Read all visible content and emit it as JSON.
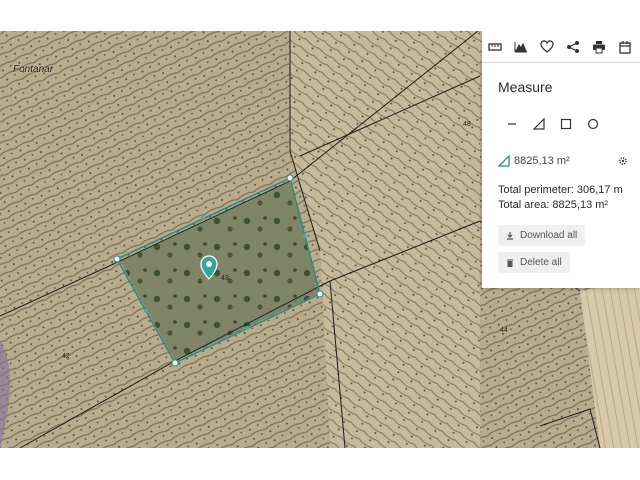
{
  "map": {
    "place_label": "Fontanar",
    "parcel_numbers": [
      "43",
      "48",
      "42",
      "44"
    ],
    "colors": {
      "terrain_base": "#b7a98c",
      "terrain_light": "#d2c6aa",
      "vegetation": "#3f4a2c",
      "boundary_lines": "#1c1c1c",
      "measure_polygon": "#2e8a7a",
      "marker": "#2ea79d"
    }
  },
  "toolbar": {
    "buttons": [
      "ruler-icon",
      "elevation-profile-icon",
      "favorite-icon",
      "share-icon",
      "print-icon",
      "export-icon"
    ]
  },
  "panel": {
    "title": "Measure",
    "tools": [
      "line-tool-icon",
      "area-tool-icon",
      "rectangle-tool-icon",
      "circle-tool-icon"
    ],
    "measurement": "8825,13 m²",
    "total_perimeter": "Total perimeter: 306,17 m",
    "total_area": "Total area: 8825,13 m²",
    "download_all": "Download all",
    "delete_all": "Delete all"
  }
}
